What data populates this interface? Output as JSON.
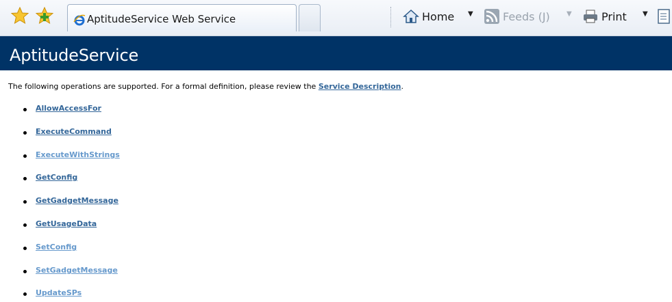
{
  "browser": {
    "tab_title": "AptitudeService Web Service",
    "commands": {
      "home": "Home",
      "feeds": "Feeds (J)",
      "print": "Print"
    }
  },
  "page": {
    "title": "AptitudeService",
    "intro_text": "The following operations are supported. For a formal definition, please review the ",
    "service_description_link": "Service Description",
    "intro_end": ".",
    "operations": [
      {
        "name": "AllowAccessFor",
        "visited": false
      },
      {
        "name": "ExecuteCommand",
        "visited": false
      },
      {
        "name": "ExecuteWithStrings",
        "visited": true
      },
      {
        "name": "GetConfig",
        "visited": false
      },
      {
        "name": "GetGadgetMessage",
        "visited": false
      },
      {
        "name": "GetUsageData",
        "visited": false
      },
      {
        "name": "SetConfig",
        "visited": true
      },
      {
        "name": "SetGadgetMessage",
        "visited": true
      },
      {
        "name": "UpdateSPs",
        "visited": true
      }
    ]
  },
  "colors": {
    "banner": "#003366",
    "link": "#336699",
    "visited_link": "#6699cc"
  }
}
